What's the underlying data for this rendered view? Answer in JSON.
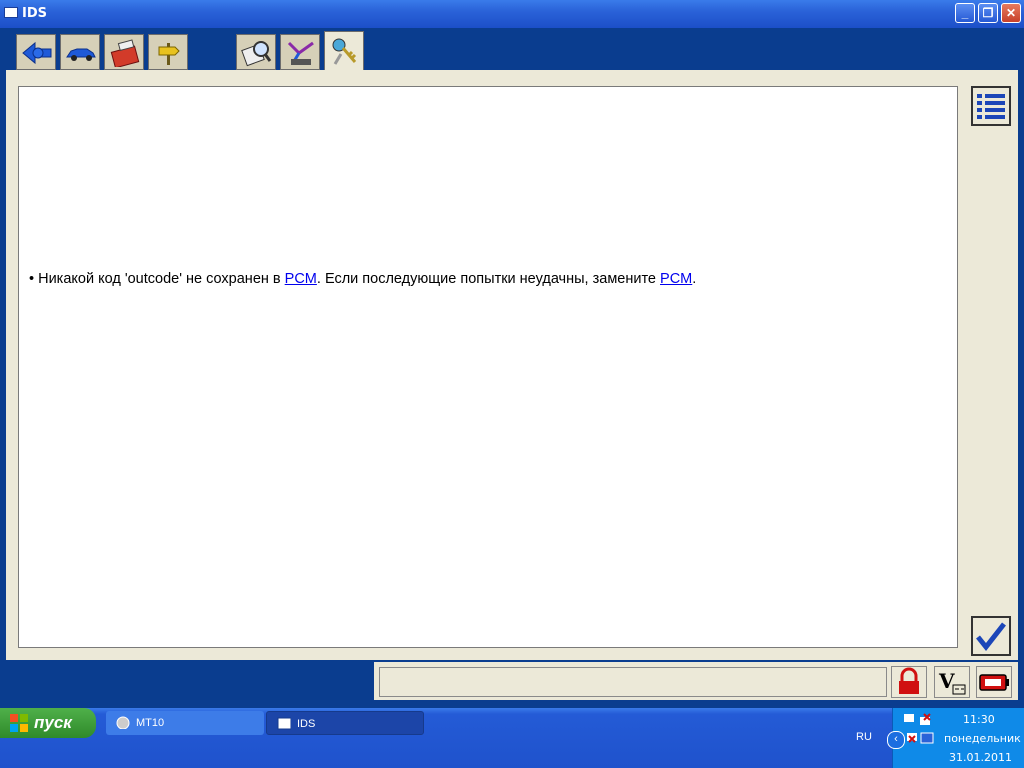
{
  "window": {
    "title": "IDS"
  },
  "tabs": [
    {
      "icon": "arrow-back-icon"
    },
    {
      "icon": "vehicle-icon"
    },
    {
      "icon": "toolbox-icon"
    },
    {
      "icon": "direction-sign-icon"
    },
    {
      "icon": "magnifier-document-icon"
    },
    {
      "icon": "network-tools-icon"
    },
    {
      "icon": "keys-icon",
      "active": true
    }
  ],
  "message": {
    "bullet": "•",
    "part1": "Никакой код 'outcode' не сохранен в ",
    "link1": "PCM",
    "part2": ". Если последующие попытки неудачны, замените ",
    "link2": "PCM",
    "part3": "."
  },
  "side_buttons": {
    "list": "list-icon",
    "confirm": "checkmark-icon"
  },
  "status_icons": [
    "lock-icon",
    "voltage-icon",
    "battery-icon"
  ],
  "taskbar": {
    "start_label": "пуск",
    "tasks": [
      {
        "label": "MT10",
        "active": false
      },
      {
        "label": "IDS",
        "active": true
      }
    ],
    "language": "RU",
    "time": "11:30",
    "day": "понедельник",
    "date": "31.01.2011"
  }
}
